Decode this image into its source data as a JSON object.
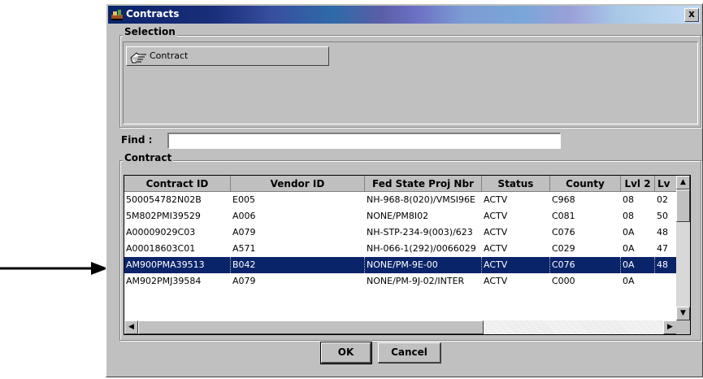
{
  "window": {
    "title": "Contracts",
    "close_label": "x"
  },
  "selection": {
    "label": "Selection",
    "button_label": "Contract"
  },
  "find": {
    "label": "Find :",
    "value": ""
  },
  "contract_group": {
    "label": "Contract"
  },
  "grid": {
    "columns": [
      "Contract ID",
      "Vendor ID",
      "Fed State Proj Nbr",
      "Status",
      "County",
      "Lvl 2",
      "Lv"
    ],
    "rows": [
      [
        "500054782N02B",
        "E005",
        "NH-968-8(020)/VMSI96E",
        "ACTV",
        "C968",
        "08",
        "02"
      ],
      [
        "5M802PMI39529",
        "A006",
        "NONE/PM8I02",
        "ACTV",
        "C081",
        "08",
        "50"
      ],
      [
        "A00009029C03",
        "A079",
        "NH-STP-234-9(003)/623",
        "ACTV",
        "C076",
        "0A",
        "48"
      ],
      [
        "A00018603C01",
        "A571",
        "NH-066-1(292)/0066029",
        "ACTV",
        "C029",
        "0A",
        "47"
      ],
      [
        "AM900PMA39513",
        "B042",
        "NONE/PM-9E-00",
        "ACTV",
        "C076",
        "0A",
        "48"
      ],
      [
        "AM902PMJ39584",
        "A079",
        "NONE/PM-9J-02/INTER",
        "ACTV",
        "C000",
        "0A",
        ""
      ]
    ],
    "selected_row": 4
  },
  "buttons": {
    "ok": "OK",
    "cancel": "Cancel"
  },
  "colors": {
    "selection": "#0a246a",
    "face": "#c0c0c0"
  }
}
